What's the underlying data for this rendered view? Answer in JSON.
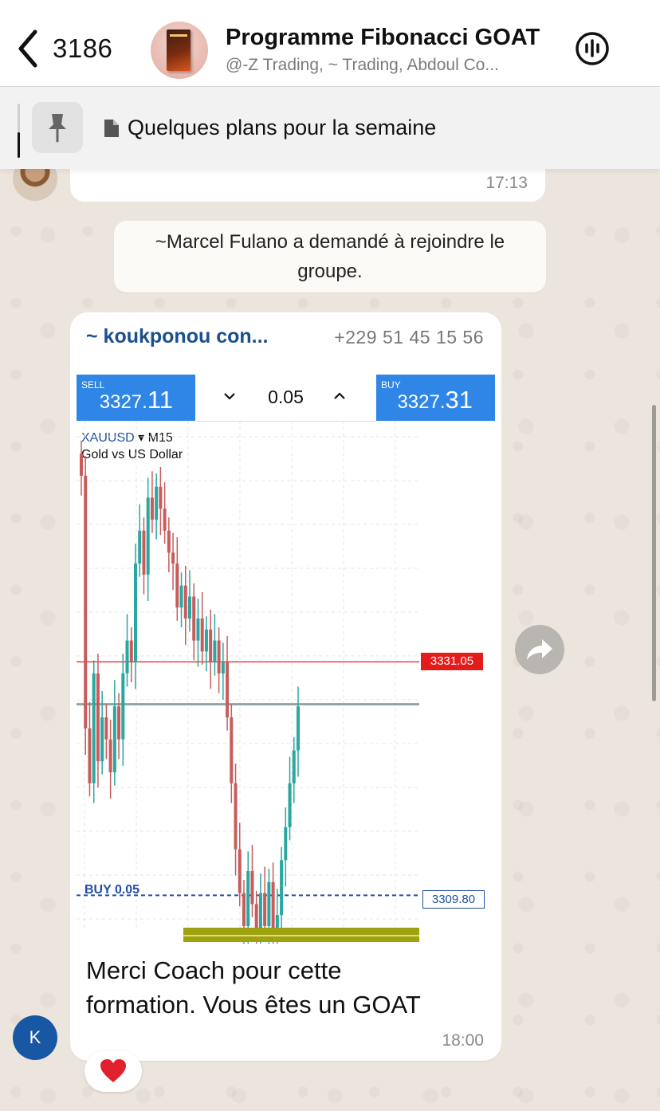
{
  "header": {
    "back_count": "3186",
    "title": "Programme Fibonacci GOAT",
    "subtitle": "@-Z Trading, ~ Trading, Abdoul Co..."
  },
  "pinned": {
    "text": "Quelques plans pour la semaine"
  },
  "previous_message": {
    "time": "17:13"
  },
  "system_message": {
    "line1": "~Marcel Fulano a demandé à rejoindre le",
    "line2": "groupe."
  },
  "message": {
    "sender_name": "~ koukponou con...",
    "sender_phone": "+229 51 45 15 56",
    "text_line1": "Merci Coach pour cette",
    "text_line2": "formation. Vous êtes un GOAT",
    "time": "18:00",
    "avatar_letter": "K",
    "reaction": "heart"
  },
  "trade": {
    "sell_label": "SELL",
    "sell_price_main": "3327.",
    "sell_price_big": "11",
    "buy_label": "BUY",
    "buy_price_main": "3327.",
    "buy_price_big": "31",
    "lot": "0.05",
    "symbol": "XAUUSD",
    "timeframe": "▾ M15",
    "description": "Gold vs US Dollar",
    "buy_order_label": "BUY 0.05"
  },
  "chart_data": {
    "type": "candlestick",
    "symbol": "XAUUSD",
    "timeframe": "M15",
    "title": "Gold vs US Dollar",
    "levels": [
      {
        "name": "red-level",
        "price": 3331.05,
        "color": "#e31b1b"
      },
      {
        "name": "buy-order",
        "price": 3309.8,
        "color": "#1f4fa5"
      },
      {
        "name": "current-price",
        "price": 3327.2,
        "color": "#8fa3a8"
      }
    ],
    "bid": 3327.11,
    "ask": 3327.31,
    "ylim": [
      3305.4,
      3353
    ],
    "closes": [
      3348,
      3325,
      3320,
      3330,
      3322,
      3326,
      3324,
      3321,
      3327,
      3324,
      3330,
      3333,
      3331,
      3340,
      3343,
      3339,
      3346,
      3344,
      3347,
      3345,
      3343,
      3341,
      3340,
      3336,
      3338,
      3335,
      3337,
      3333,
      3335,
      3332,
      3334,
      3331,
      3333,
      3330,
      3331,
      3326,
      3320,
      3314,
      3310,
      3307,
      3312,
      3309,
      3306,
      3310,
      3307,
      3311,
      3306,
      3308,
      3313,
      3316,
      3320,
      3323,
      3327
    ]
  },
  "colors": {
    "bull": "#2aa7a0",
    "bear": "#c85c5c",
    "accent_blue": "#2f86e6",
    "sender_name": "#1a4f8e"
  }
}
